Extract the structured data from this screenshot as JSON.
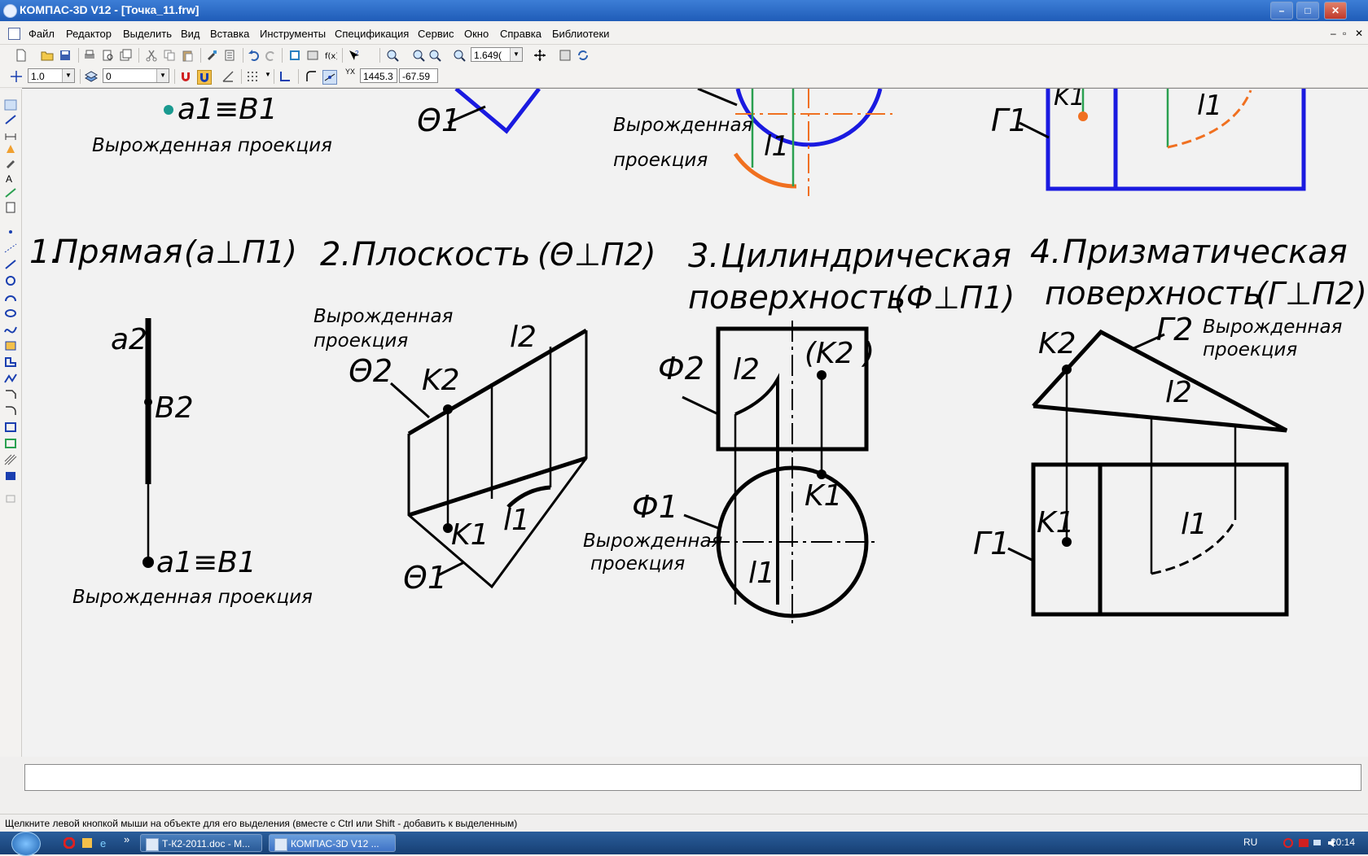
{
  "window": {
    "title": "КОМПАС-3D V12 - [Точка_11.frw]",
    "buttons": {
      "minimize": "–",
      "maximize": "□",
      "close": "✕"
    }
  },
  "menu": {
    "items": [
      "Файл",
      "Редактор",
      "Выделить",
      "Вид",
      "Вставка",
      "Инструменты",
      "Спецификация",
      "Сервис",
      "Окно",
      "Справка",
      "Библиотеки"
    ],
    "mdi": {
      "minimize": "–",
      "restore": "▫",
      "close": "✕"
    }
  },
  "toolbar1": {
    "zoom_value": "1.649("
  },
  "toolbar2": {
    "step_value": "1.0",
    "layer_value": "0",
    "coord_x": "1445.3",
    "coord_y": "-67.59",
    "coord_label": "YX"
  },
  "drawing": {
    "top": {
      "a1b1": "a1≡B1",
      "degenerate_left": "Вырожденная проекция",
      "theta1": "Θ1",
      "degenerate_mid_1": "Вырожденная",
      "degenerate_mid_2": "проекция",
      "l1": "l1",
      "gamma1": "Г1",
      "k1": "K1",
      "l1_right": "l1"
    },
    "sections": [
      {
        "num": "1.",
        "title": "Прямая",
        "formula": "(a⊥П1)"
      },
      {
        "num": "2.",
        "title": "Плоскость",
        "formula": "(Θ⊥П2)"
      },
      {
        "num": "3.",
        "title_1": "Цилиндрическая",
        "title_2": "поверхность",
        "formula": "(Ф⊥П1)"
      },
      {
        "num": "4.",
        "title_1": "Призматическая",
        "title_2": "поверхность",
        "formula": "(Г⊥П2)"
      }
    ],
    "s1": {
      "a2": "a2",
      "b2": "B2",
      "a1b1": "a1≡B1",
      "degenerate": "Вырожденная проекция"
    },
    "s2": {
      "degenerate_1": "Вырожденная",
      "degenerate_2": "проекция",
      "theta2": "Θ2",
      "k2": "K2",
      "l2": "l2",
      "k1": "K1",
      "l1": "l1",
      "theta1": "Θ1"
    },
    "s3": {
      "phi2": "Ф2",
      "l2": "l2",
      "k2": "(K2 )",
      "phi1": "Ф1",
      "k1": "K1",
      "degenerate_1": "Вырожденная",
      "degenerate_2": "проекция",
      "l1": "l1"
    },
    "s4": {
      "k2": "K2",
      "gamma2": "Г2",
      "degenerate_1": "Вырожденная",
      "degenerate_2": "проекция",
      "l2": "l2",
      "gamma1": "Г1",
      "k1": "K1",
      "l1": "l1"
    }
  },
  "status": {
    "hint": "Щелкните левой кнопкой мыши на объекте для его выделения (вместе с Ctrl или Shift - добавить к выделенным)"
  },
  "taskbar": {
    "tasks": [
      "Т-К2-2011.doc - М...",
      "КОМПАС-3D V12 ..."
    ],
    "lang": "RU",
    "time": "20:14",
    "more": "»"
  },
  "colors": {
    "line": "#000000",
    "blue": "#1a1ae0",
    "orange": "#f07020",
    "green": "#2aa050",
    "teal": "#1a9a90"
  }
}
